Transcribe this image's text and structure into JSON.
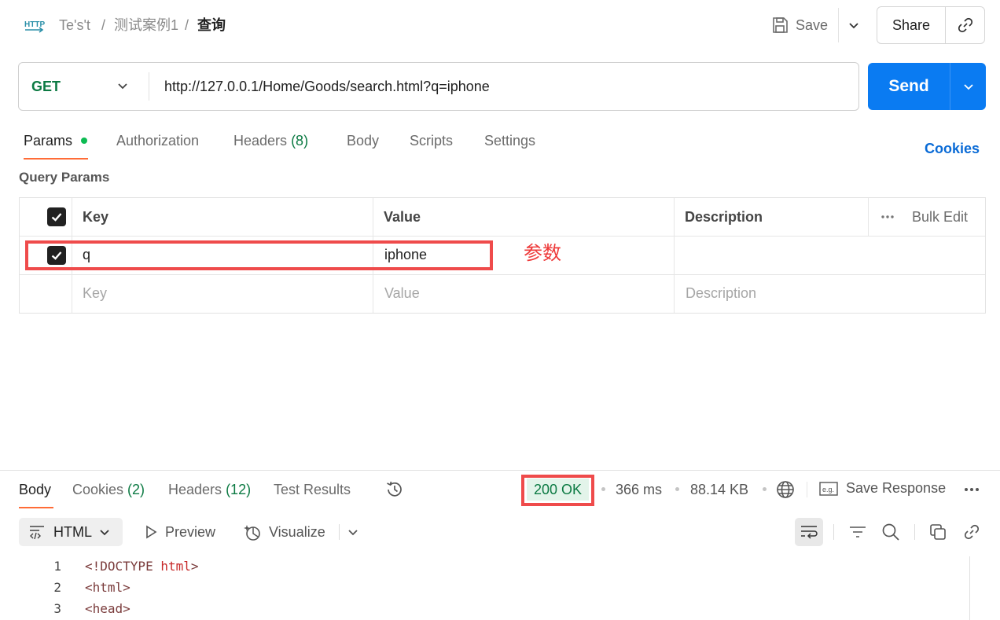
{
  "header": {
    "breadcrumb": [
      "Te's't",
      "测试案例1",
      "查询"
    ],
    "separator": "/",
    "save_label": "Save",
    "share_label": "Share"
  },
  "request": {
    "method": "GET",
    "url": "http://127.0.0.1/Home/Goods/search.html?q=iphone",
    "send_label": "Send"
  },
  "request_tabs": [
    {
      "label": "Params",
      "count": "",
      "active": true
    },
    {
      "label": "Authorization",
      "count": ""
    },
    {
      "label": "Headers",
      "count": "(8)"
    },
    {
      "label": "Body",
      "count": ""
    },
    {
      "label": "Scripts",
      "count": ""
    },
    {
      "label": "Settings",
      "count": ""
    }
  ],
  "cookies_label": "Cookies",
  "query_params": {
    "title": "Query Params",
    "columns": [
      "Key",
      "Value",
      "Description"
    ],
    "bulk_edit": "Bulk Edit",
    "rows": [
      {
        "key": "q",
        "value": "iphone",
        "description": "",
        "checked": true
      }
    ],
    "placeholders": {
      "key": "Key",
      "value": "Value",
      "description": "Description"
    }
  },
  "annotation": "参数",
  "response": {
    "tabs": [
      {
        "label": "Body",
        "count": "",
        "active": true
      },
      {
        "label": "Cookies",
        "count": "(2)"
      },
      {
        "label": "Headers",
        "count": "(12)"
      },
      {
        "label": "Test Results",
        "count": ""
      }
    ],
    "status": "200 OK",
    "time": "366 ms",
    "size": "88.14 KB",
    "save_response_label": "Save Response",
    "format": "HTML",
    "preview_label": "Preview",
    "visualize_label": "Visualize",
    "code_lines": [
      {
        "n": "1",
        "pre": "<!DOCTYPE ",
        "kw": "html",
        "post": ">"
      },
      {
        "n": "2",
        "pre": "<html>",
        "kw": "",
        "post": ""
      },
      {
        "n": "3",
        "pre": "<head>",
        "kw": "",
        "post": ""
      }
    ]
  },
  "colors": {
    "send": "#0a7bf2",
    "method": "#0c7a43",
    "accent": "#ff6c37",
    "highlight": "#ef4b4b"
  }
}
